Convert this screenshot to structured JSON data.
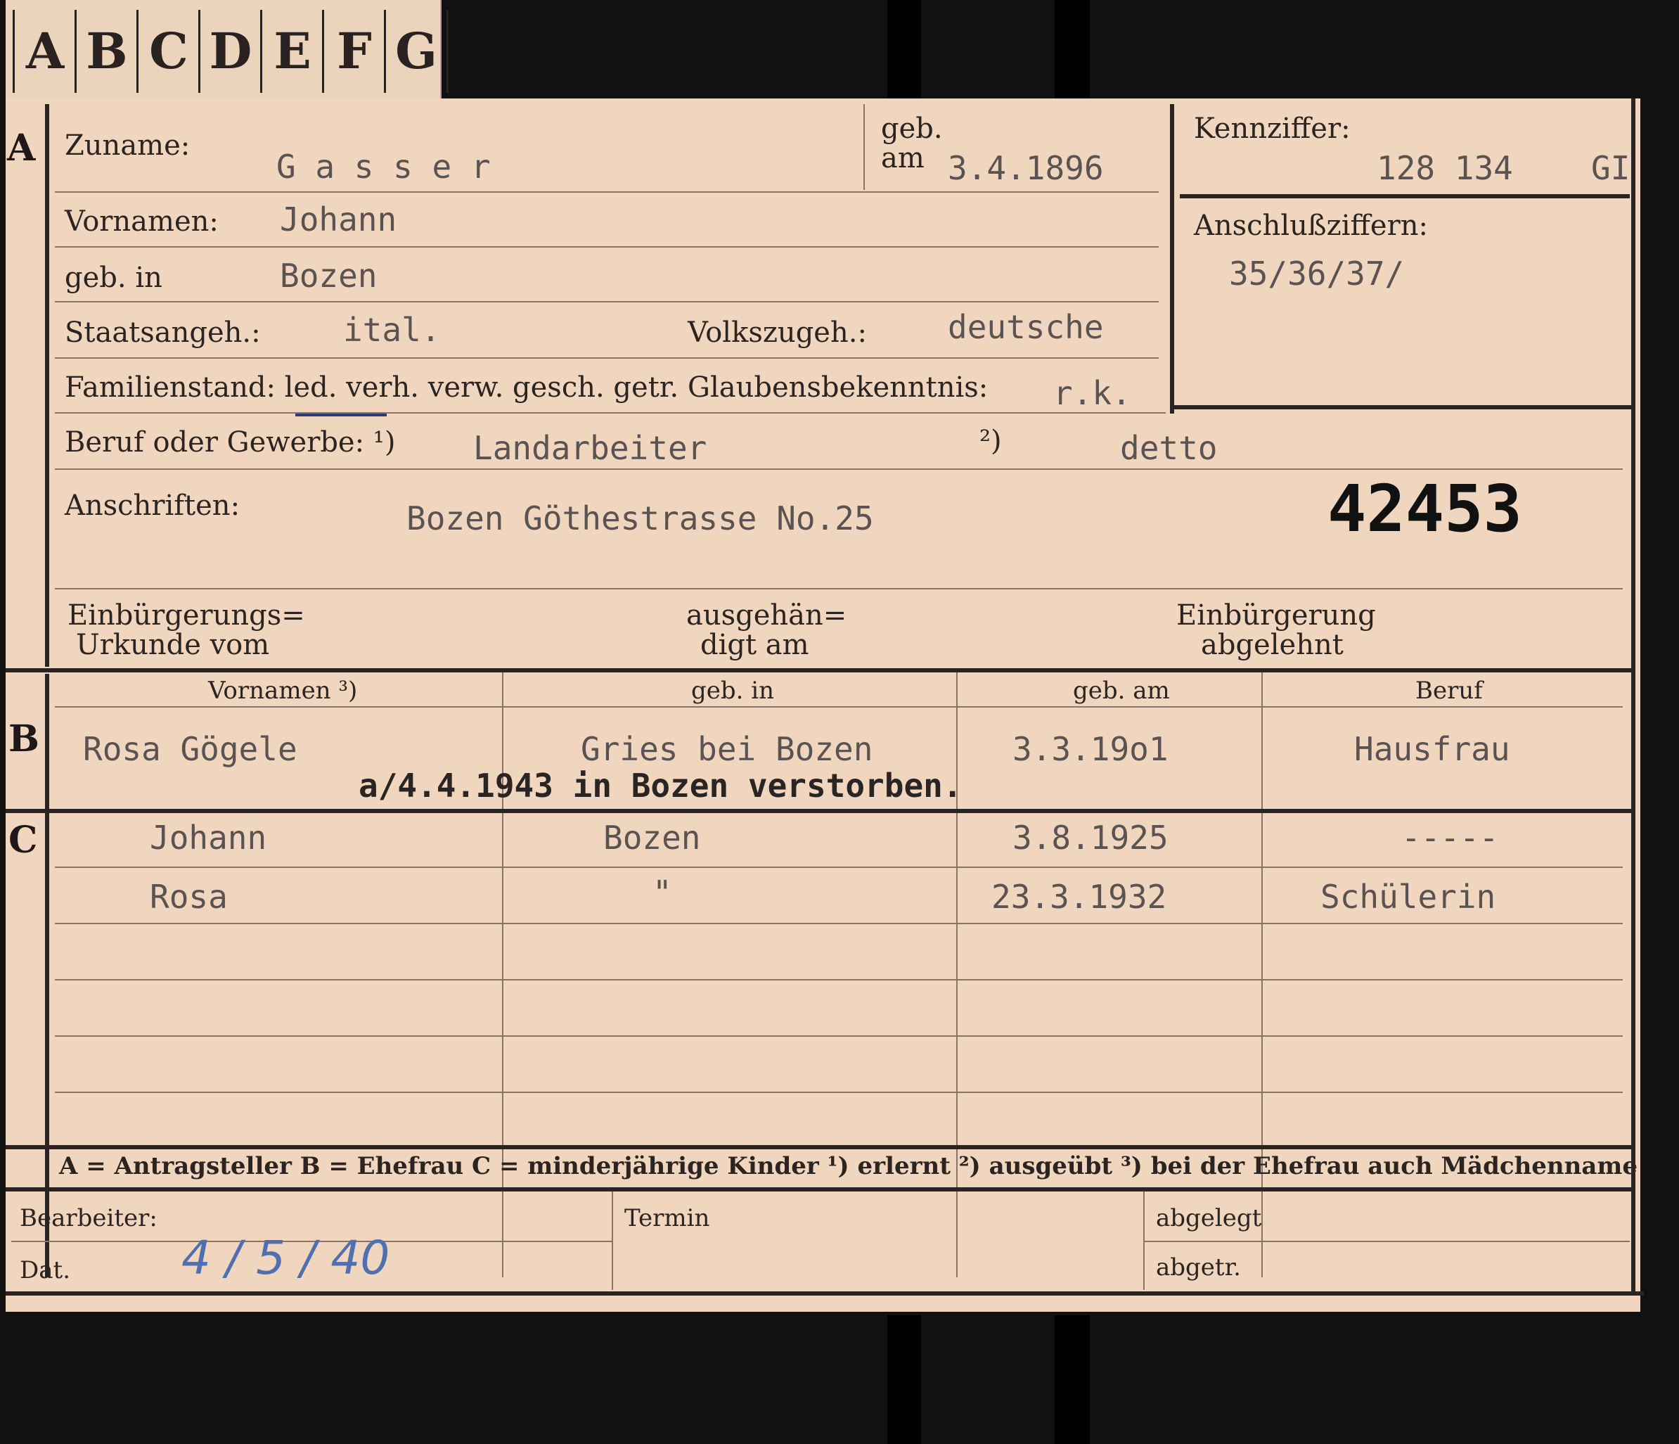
{
  "tabs": [
    "A",
    "B",
    "C",
    "D",
    "E",
    "F",
    "G"
  ],
  "section_a": {
    "marker": "A",
    "surname_label": "Zuname:",
    "surname_value": "G a s s e r",
    "geb_label": "geb.",
    "am_label": "am",
    "birthdate_value": "3.4.1896",
    "kennziffer_label": "Kennziffer:",
    "kennziffer_value": "128 134",
    "kennziffer_suffix": "GI",
    "anschluss_label": "Anschlußziffern:",
    "anschluss_value": "35/36/37/",
    "vornamen_label": "Vornamen:",
    "vornamen_value": "Johann",
    "gebin_label": "geb. in",
    "gebin_value": "Bozen",
    "staat_label": "Staatsangeh.:",
    "staat_value": "ital.",
    "volk_label": "Volkszugeh.:",
    "volk_value": "deutsche",
    "familienstand_label": "Familienstand: led. verh. verw. gesch. getr.",
    "glauben_label": "Glaubensbekenntnis:",
    "glauben_value": "r.k.",
    "beruf_label": "Beruf oder Gewerbe: ¹)",
    "beruf_value": "Landarbeiter",
    "beruf2_label": "²)",
    "beruf2_value": "detto",
    "anschriften_label": "Anschriften:",
    "anschriften_value": "Bozen Göthestrasse No.25",
    "stamp_number": "42453",
    "einb_urkunde_label_1": "Einbürgerungs=",
    "einb_urkunde_label_2": "Urkunde vom",
    "ausgehaen_label_1": "ausgehän=",
    "ausgehaen_label_2": "digt am",
    "einb_abgelehnt_label_1": "Einbürgerung",
    "einb_abgelehnt_label_2": "abgelehnt"
  },
  "columns": {
    "vornamen": "Vornamen ³)",
    "gebin": "geb. in",
    "gebam": "geb. am",
    "beruf": "Beruf"
  },
  "section_b": {
    "marker": "B",
    "vornamen": "Rosa Gögele",
    "gebin": "Gries bei Bozen",
    "gebam": "3.3.19o1",
    "beruf": "Hausfrau",
    "note": "a/4.4.1943 in Bozen verstorben."
  },
  "section_c": {
    "marker": "C",
    "rows": [
      {
        "vornamen": "Johann",
        "gebin": "Bozen",
        "gebam": "3.8.1925",
        "beruf": "-----"
      },
      {
        "vornamen": "Rosa",
        "gebin": "\"",
        "gebam": "23.3.1932",
        "beruf": "Schülerin"
      }
    ]
  },
  "legend": "A = Antragsteller  B = Ehefrau  C = minderjährige Kinder  ¹) erlernt  ²) ausgeübt  ³) bei der Ehefrau auch Mädchenname",
  "footer": {
    "bearbeiter_label": "Bearbeiter:",
    "dat_label": "Dat.",
    "dat_value": "4 / 5 / 40",
    "termin_label": "Termin",
    "abgelegt_label": "abgelegt",
    "abgetr_label": "abgetr."
  },
  "colors": {
    "card": "#f0d6bf",
    "ink": "#2a2220",
    "typewriter": "#5a5352",
    "handwriting": "#4f6fb0"
  }
}
